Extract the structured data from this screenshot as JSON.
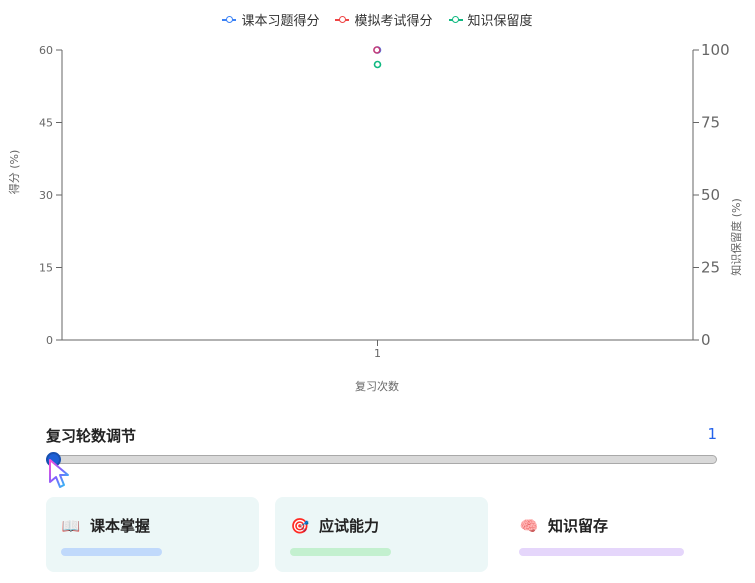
{
  "legend": [
    {
      "label": "课本习题得分",
      "color": "#3b82f6"
    },
    {
      "label": "模拟考试得分",
      "color": "#ef4444"
    },
    {
      "label": "知识保留度",
      "color": "#10b981"
    }
  ],
  "chart_data": {
    "type": "line",
    "categories": [
      "1"
    ],
    "series": [
      {
        "name": "课本习题得分",
        "axis": "left",
        "values": [
          60
        ],
        "color": "#3b82f6"
      },
      {
        "name": "模拟考试得分",
        "axis": "left",
        "values": [
          60
        ],
        "color": "#ef4444"
      },
      {
        "name": "知识保留度",
        "axis": "right",
        "values": [
          95
        ],
        "color": "#10b981"
      }
    ],
    "xlabel": "复习次数",
    "ylabel_left": "得分 (%)",
    "ylabel_right": "知识保留度 (%)",
    "ylim_left": [
      0,
      60
    ],
    "yticks_left": [
      0,
      15,
      30,
      45,
      60
    ],
    "ylim_right": [
      0,
      100
    ],
    "yticks_right": [
      0,
      25,
      50,
      75,
      100
    ],
    "grid": false,
    "legend_position": "top-center"
  },
  "slider": {
    "title": "复习轮数调节",
    "value": "1",
    "min": 1,
    "max": 10,
    "current": 1
  },
  "cards": [
    {
      "icon": "📖",
      "icon_name": "book-icon",
      "title": "课本掌握",
      "bg": "#ecf7f7",
      "bar_color": "#c0d9fb",
      "bar_level": 0.55
    },
    {
      "icon": "🎯",
      "icon_name": "target-icon",
      "title": "应试能力",
      "bg": "#ecf7f7",
      "bar_color": "#c3f0cf",
      "bar_level": 0.55
    },
    {
      "icon": "🧠",
      "icon_name": "brain-icon",
      "title": "知识留存",
      "bg": "#ffffff",
      "bar_color": "#e5d6fb",
      "bar_level": 0.9
    }
  ]
}
